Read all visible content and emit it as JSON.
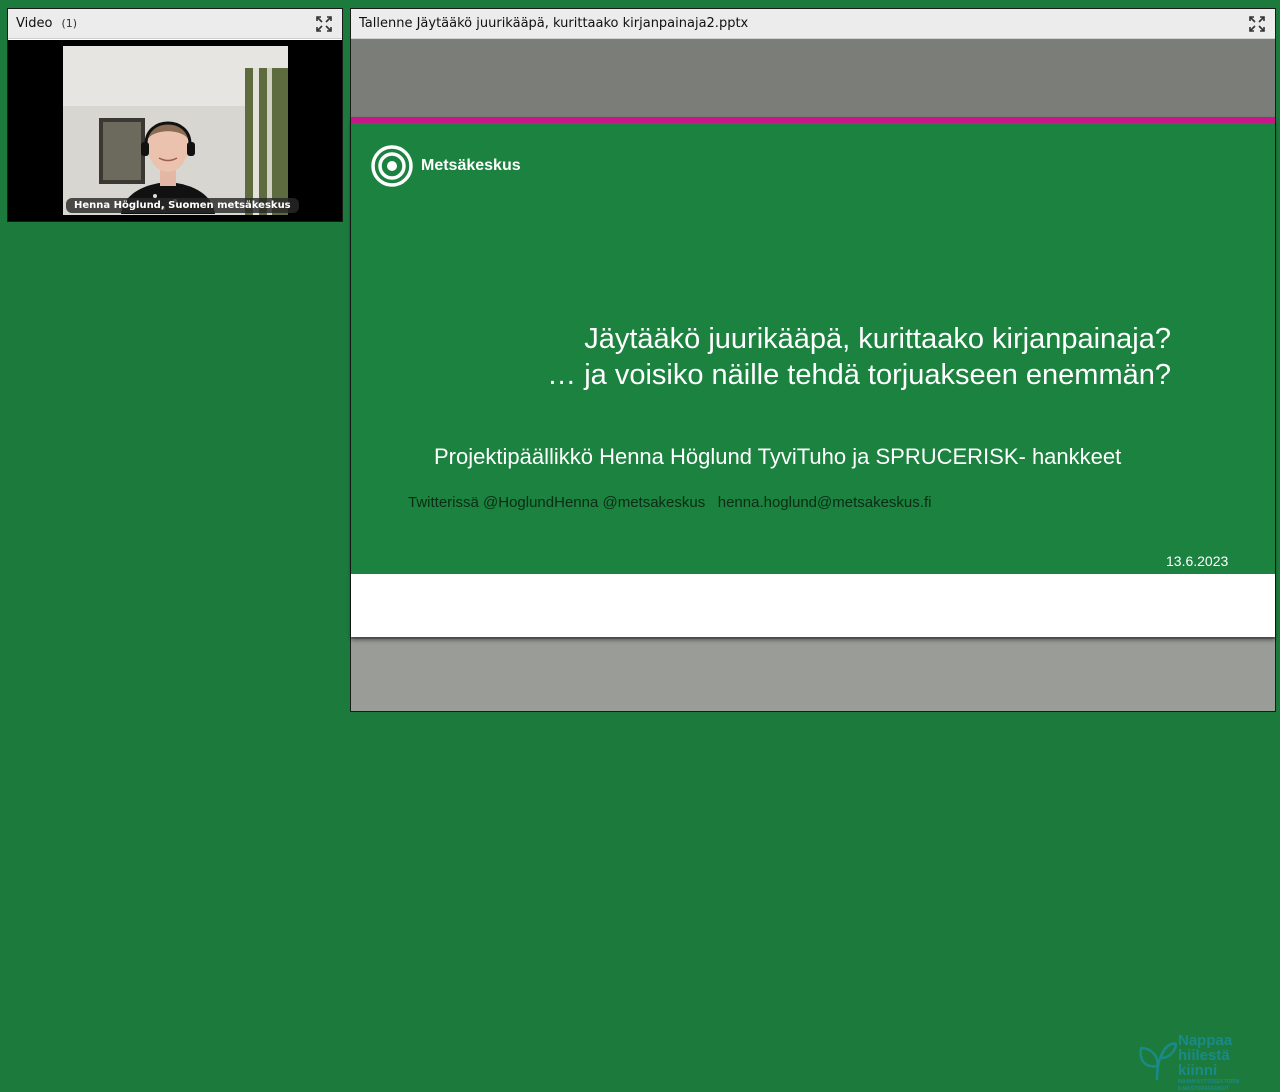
{
  "video_pod": {
    "title": "Video",
    "count": "(1)",
    "speaker_label": "Henna Höglund, Suomen metsäkeskus",
    "fullscreen_icon": "fullscreen-icon"
  },
  "share_pod": {
    "title": "Tallenne Jäytääkö juurikääpä, kurittaako kirjanpainaja2.pptx",
    "fullscreen_icon": "fullscreen-icon"
  },
  "slide": {
    "brand": "Metsäkeskus",
    "title_line1": "Jäytääkö juurikääpä, kurittaako kirjanpainaja?",
    "title_line2": "… ja voisiko näille tehdä torjuakseen enemmän?",
    "subtitle": "Projektipäällikkö Henna Höglund TyviTuho ja SPRUCERISK- hankkeet",
    "contact": "Twitterissä @HoglundHenna @metsakeskus   henna.hoglund@metsakeskus.fi",
    "date": "13.6.2023",
    "footer_logo": {
      "line1": "Nappaa",
      "line2": "hiilestä",
      "line3": "kiinni",
      "small1": "MAANKÄYTTÖSEKTORIN",
      "small2": "ILMASTORATKAISUT"
    }
  },
  "colors": {
    "background": "#1d7a3d",
    "slide_green": "#1b823f",
    "accent_band": "#c8168a",
    "logo_teal": "#1a8a88"
  }
}
